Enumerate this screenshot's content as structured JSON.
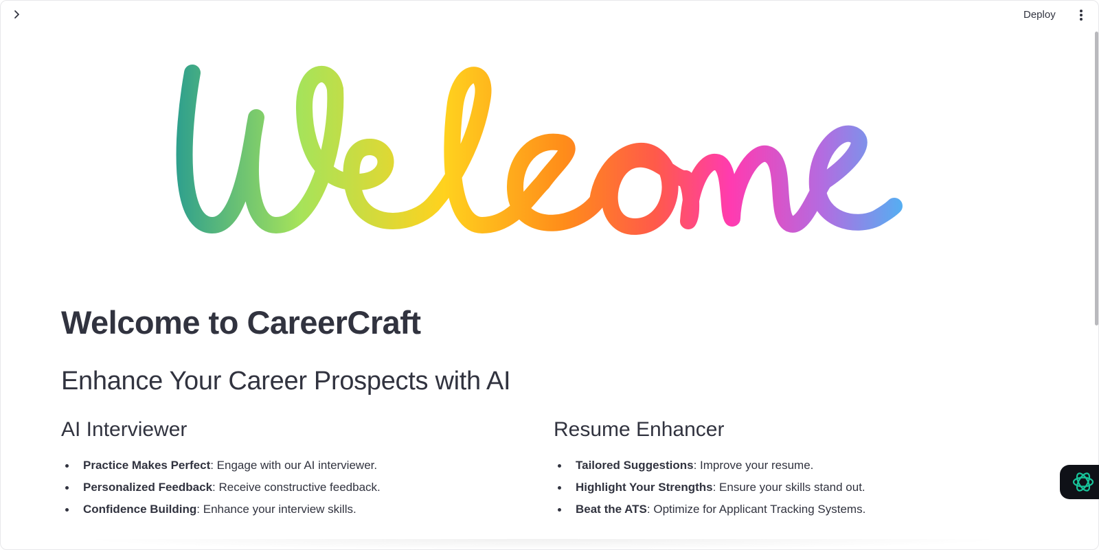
{
  "header": {
    "deploy_label": "Deploy",
    "icons": {
      "sidebar_toggle": "chevron-right-icon",
      "menu": "kebab-menu-icon"
    }
  },
  "hero": {
    "text": "Welcome",
    "gradient_colors": [
      "#2a9d8f",
      "#a6e35a",
      "#ffd21e",
      "#ff8c1a",
      "#ff5a4a",
      "#ff3bb0",
      "#b46be0",
      "#38c3f7"
    ]
  },
  "main": {
    "title": "Welcome to CareerCraft",
    "subtitle": "Enhance Your Career Prospects with AI",
    "features": [
      {
        "heading": "AI Interviewer",
        "items": [
          {
            "term": "Practice Makes Perfect",
            "desc": ": Engage with our AI interviewer."
          },
          {
            "term": "Personalized Feedback",
            "desc": ": Receive constructive feedback."
          },
          {
            "term": "Confidence Building",
            "desc": ": Enhance your interview skills."
          }
        ]
      },
      {
        "heading": "Resume Enhancer",
        "items": [
          {
            "term": "Tailored Suggestions",
            "desc": ": Improve your resume."
          },
          {
            "term": "Highlight Your Strengths",
            "desc": ": Ensure your skills stand out."
          },
          {
            "term": "Beat the ATS",
            "desc": ": Optimize for Applicant Tracking Systems."
          }
        ]
      }
    ]
  },
  "assistant": {
    "icon": "openai-knot-icon",
    "accent": "#18c49a"
  }
}
